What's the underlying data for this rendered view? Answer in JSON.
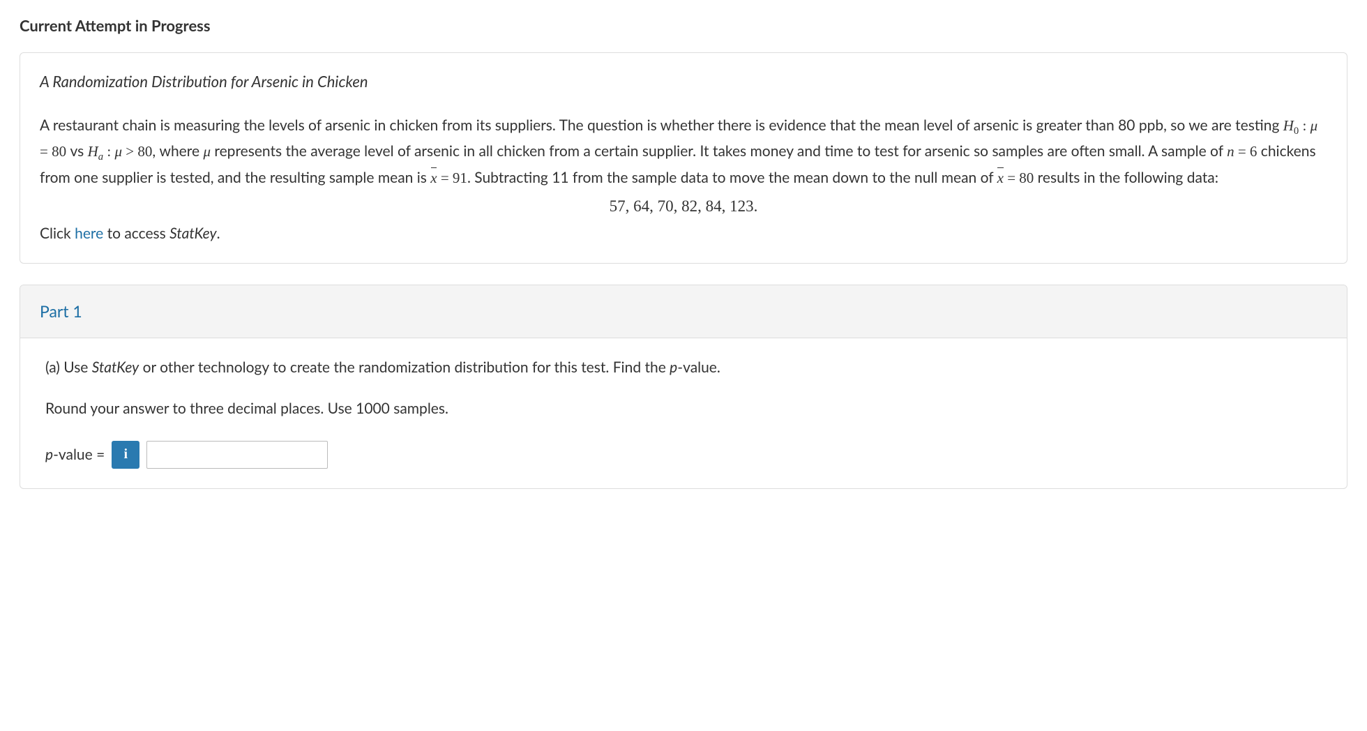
{
  "page_title": "Current Attempt in Progress",
  "question": {
    "title": "A Randomization Distribution for Arsenic in Chicken",
    "body_intro": "A restaurant chain is measuring the levels of arsenic in chicken from its suppliers. The question is whether there is evidence that the mean level of arsenic is greater than 80 ppb, so we are testing ",
    "h0_label": "H",
    "h0_sub": "0",
    "colon": " : ",
    "mu": "μ",
    "eq80": " = 80",
    "vs": " vs ",
    "ha_label": "H",
    "ha_sub": "a",
    "gt80": " > 80",
    "where": ", where ",
    "mu2": "μ",
    "body_mid": " represents the average level of arsenic in all chicken from a certain supplier. It takes money and time to test for arsenic so samples are often small. A sample of ",
    "n_sym": "n",
    "n_eq": " = 6",
    "body_mid2": " chickens from one supplier is tested, and the resulting sample mean is ",
    "xbar": "x",
    "xbar_eq": " = 91",
    "body_mid3": ". Subtracting 11 from the sample data to move the mean down to the null mean of ",
    "xbar2": "x",
    "xbar2_eq": " = 80",
    "body_end": " results in the following data:",
    "data_values": "57,  64,  70,  82,  84,  123.",
    "click_pre": "Click ",
    "click_link": "here",
    "click_post": " to access ",
    "statkey": "StatKey",
    "period": "."
  },
  "part1": {
    "header": "Part 1",
    "prompt_pre": "(a) Use ",
    "statkey": "StatKey",
    "prompt_mid": " or other technology to create the randomization distribution for this test. Find the ",
    "pval_word_p": "p",
    "pval_word_rest": "-value.",
    "note": "Round your answer to three decimal places. Use 1000 samples.",
    "answer_label_p": "p",
    "answer_label_rest": "-value = ",
    "info_icon": "i",
    "input_value": ""
  }
}
